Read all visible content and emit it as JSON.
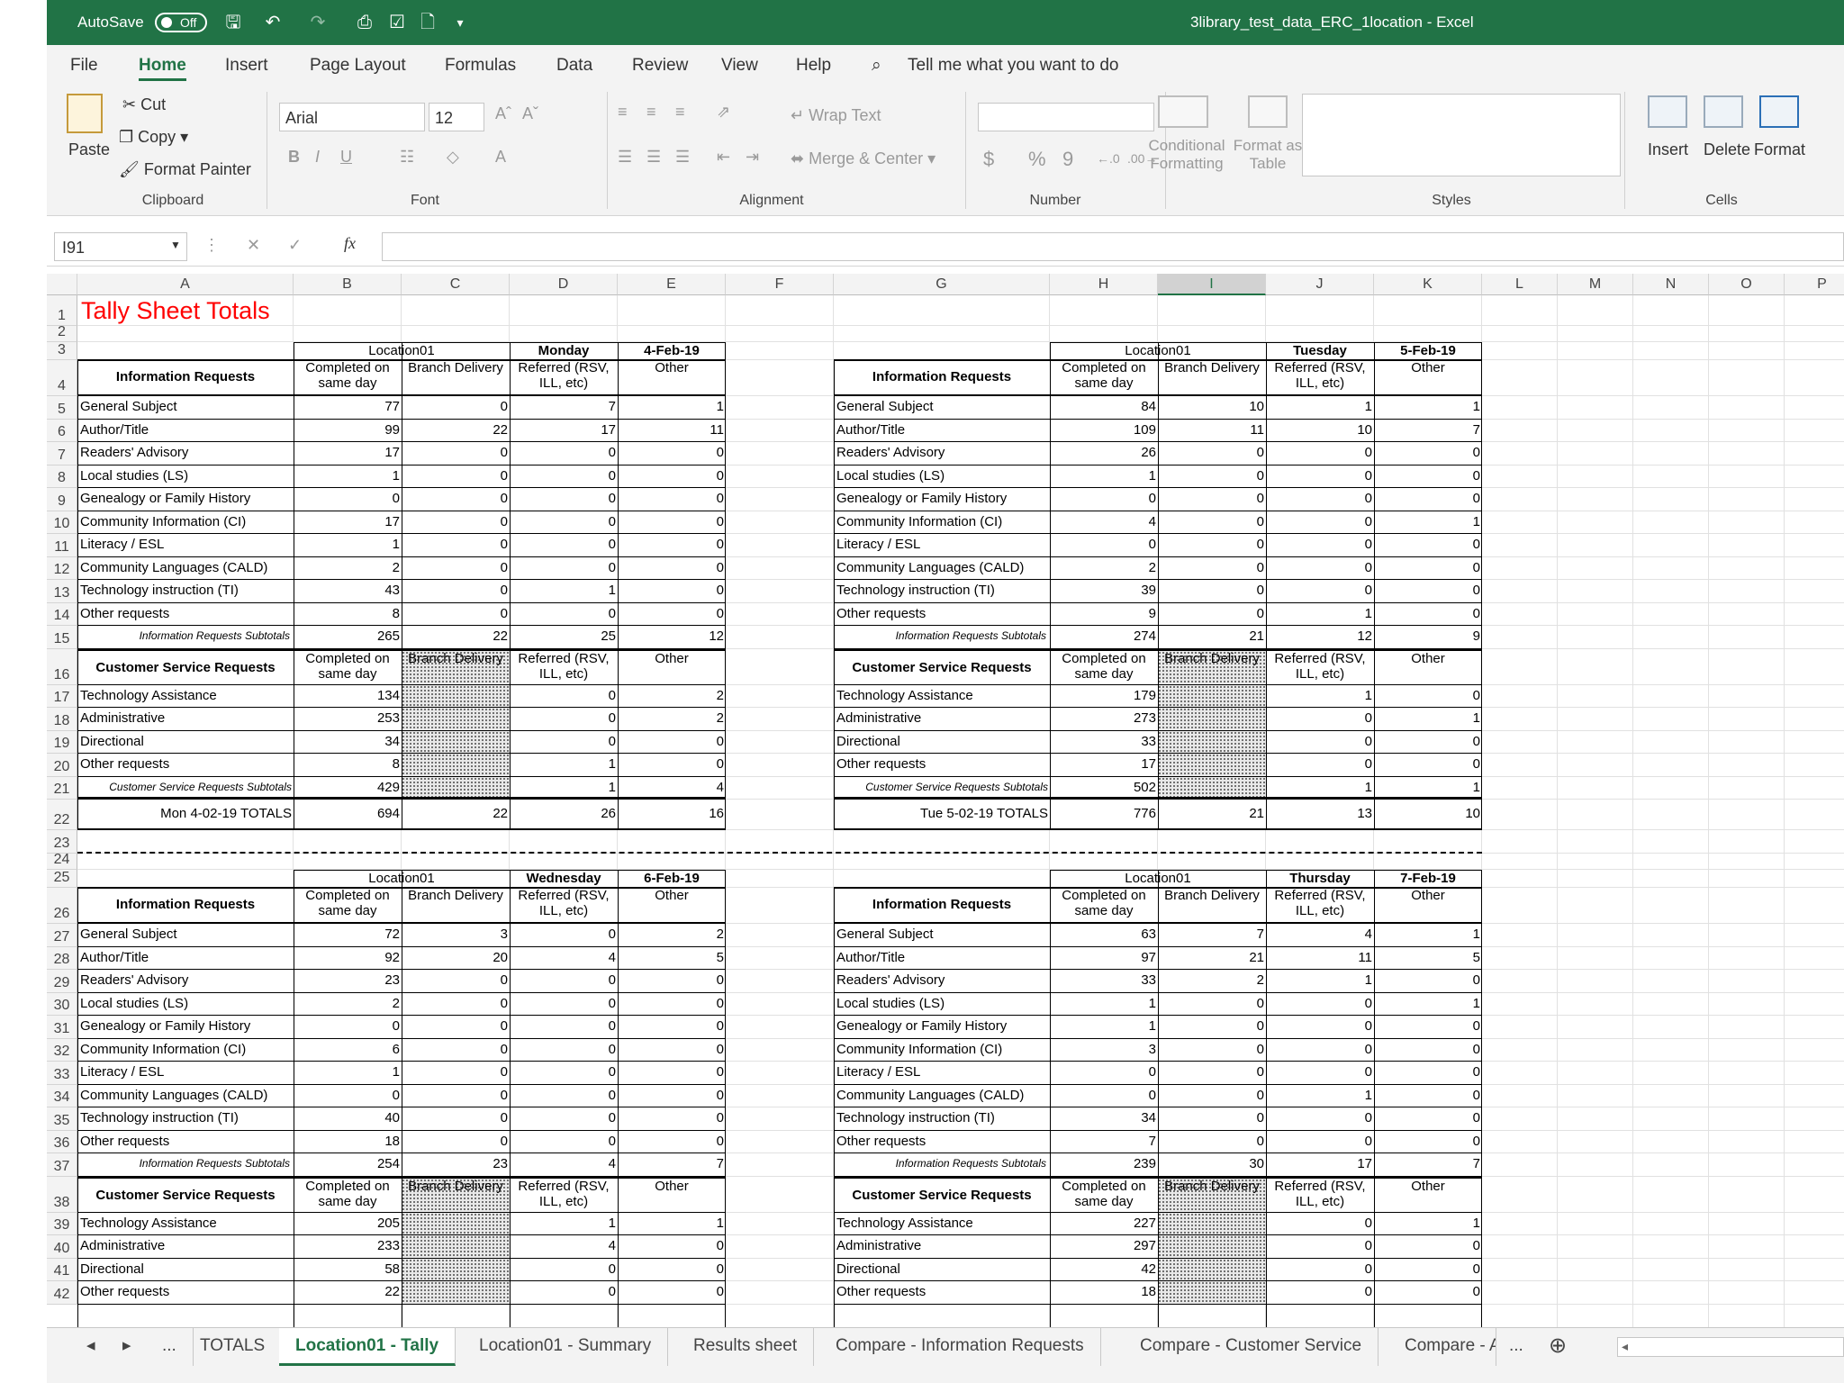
{
  "window": {
    "title": "3library_test_data_ERC_1location  -  Excel",
    "autosave_label": "AutoSave",
    "autosave_state": "Off"
  },
  "menu": {
    "tabs": [
      "File",
      "Home",
      "Insert",
      "Page Layout",
      "Formulas",
      "Data",
      "Review",
      "View",
      "Help"
    ],
    "active": "Home",
    "tell_me": "Tell me what you want to do"
  },
  "ribbon": {
    "clipboard": {
      "paste": "Paste",
      "cut": "Cut",
      "copy": "Copy",
      "format_painter": "Format Painter",
      "group": "Clipboard"
    },
    "font": {
      "name": "Arial",
      "size": "12",
      "group": "Font",
      "bold": "B",
      "italic": "I",
      "underline": "U",
      "grow": "Aˆ",
      "shrink": "Aˇ"
    },
    "alignment": {
      "wrap": "Wrap Text",
      "merge": "Merge & Center",
      "group": "Alignment"
    },
    "number": {
      "group": "Number",
      "currency": "$",
      "percent": "%",
      "comma": "9"
    },
    "styles": {
      "conditional": "Conditional Formatting",
      "format_as_table": "Format as Table",
      "group": "Styles"
    },
    "cells": {
      "insert": "Insert",
      "delete": "Delete",
      "format": "Format",
      "group": "Cells"
    }
  },
  "formula_bar": {
    "name_box": "I91",
    "formula": "",
    "fx": "fx",
    "cancel": "✕",
    "confirm": "✓"
  },
  "columns": [
    "A",
    "B",
    "C",
    "D",
    "E",
    "F",
    "G",
    "H",
    "I",
    "J",
    "K",
    "L",
    "M",
    "N",
    "O",
    "P"
  ],
  "selected_column": "I",
  "rows": [
    "1",
    "2",
    "3",
    "4",
    "5",
    "6",
    "7",
    "8",
    "9",
    "10",
    "11",
    "12",
    "13",
    "14",
    "15",
    "16",
    "17",
    "18",
    "19",
    "20",
    "21",
    "22",
    "23",
    "24",
    "25",
    "26",
    "27",
    "28",
    "29",
    "30",
    "31",
    "32",
    "33",
    "34",
    "35",
    "36",
    "37",
    "38",
    "39",
    "40",
    "41",
    "42"
  ],
  "sheet_title": "Tally Sheet Totals",
  "headers": {
    "location": "Location01",
    "info_requests": "Information Requests",
    "cs_requests": "Customer Service Requests",
    "completed": "Completed on same day",
    "branch": "Branch Delivery",
    "referred": "Referred (RSV, ILL, etc)",
    "other": "Other",
    "info_subtotals": "Information Requests Subtotals",
    "cs_subtotals": "Customer Service Requests Subtotals"
  },
  "info_labels": [
    "General Subject",
    "Author/Title",
    "Readers' Advisory",
    "Local studies (LS)",
    "Genealogy or Family History",
    "Community Information (CI)",
    "Literacy / ESL",
    "Community Languages (CALD)",
    "Technology instruction (TI)",
    "Other requests"
  ],
  "cs_labels": [
    "Technology Assistance",
    "Administrative",
    "Directional",
    "Other requests"
  ],
  "blocks": [
    {
      "day": "Monday",
      "date": "4-Feb-19",
      "info": [
        [
          "77",
          "0",
          "7",
          "1"
        ],
        [
          "99",
          "22",
          "17",
          "11"
        ],
        [
          "17",
          "0",
          "0",
          "0"
        ],
        [
          "1",
          "0",
          "0",
          "0"
        ],
        [
          "0",
          "0",
          "0",
          "0"
        ],
        [
          "17",
          "0",
          "0",
          "0"
        ],
        [
          "1",
          "0",
          "0",
          "0"
        ],
        [
          "2",
          "0",
          "0",
          "0"
        ],
        [
          "43",
          "0",
          "1",
          "0"
        ],
        [
          "8",
          "0",
          "0",
          "0"
        ]
      ],
      "info_sub": [
        "265",
        "22",
        "25",
        "12"
      ],
      "cs": [
        [
          "134",
          "",
          "0",
          "2"
        ],
        [
          "253",
          "",
          "0",
          "2"
        ],
        [
          "34",
          "",
          "0",
          "0"
        ],
        [
          "8",
          "",
          "1",
          "0"
        ]
      ],
      "cs_sub": [
        "429",
        "",
        "1",
        "4"
      ],
      "totals_label": "Mon 4-02-19 TOTALS",
      "totals": [
        "694",
        "22",
        "26",
        "16"
      ]
    },
    {
      "day": "Tuesday",
      "date": "5-Feb-19",
      "info": [
        [
          "84",
          "10",
          "1",
          "1"
        ],
        [
          "109",
          "11",
          "10",
          "7"
        ],
        [
          "26",
          "0",
          "0",
          "0"
        ],
        [
          "1",
          "0",
          "0",
          "0"
        ],
        [
          "0",
          "0",
          "0",
          "0"
        ],
        [
          "4",
          "0",
          "0",
          "1"
        ],
        [
          "0",
          "0",
          "0",
          "0"
        ],
        [
          "2",
          "0",
          "0",
          "0"
        ],
        [
          "39",
          "0",
          "0",
          "0"
        ],
        [
          "9",
          "0",
          "1",
          "0"
        ]
      ],
      "info_sub": [
        "274",
        "21",
        "12",
        "9"
      ],
      "cs": [
        [
          "179",
          "",
          "1",
          "0"
        ],
        [
          "273",
          "",
          "0",
          "1"
        ],
        [
          "33",
          "",
          "0",
          "0"
        ],
        [
          "17",
          "",
          "0",
          "0"
        ]
      ],
      "cs_sub": [
        "502",
        "",
        "1",
        "1"
      ],
      "totals_label": "Tue 5-02-19 TOTALS",
      "totals": [
        "776",
        "21",
        "13",
        "10"
      ]
    },
    {
      "day": "Wednesday",
      "date": "6-Feb-19",
      "info": [
        [
          "72",
          "3",
          "0",
          "2"
        ],
        [
          "92",
          "20",
          "4",
          "5"
        ],
        [
          "23",
          "0",
          "0",
          "0"
        ],
        [
          "2",
          "0",
          "0",
          "0"
        ],
        [
          "0",
          "0",
          "0",
          "0"
        ],
        [
          "6",
          "0",
          "0",
          "0"
        ],
        [
          "1",
          "0",
          "0",
          "0"
        ],
        [
          "0",
          "0",
          "0",
          "0"
        ],
        [
          "40",
          "0",
          "0",
          "0"
        ],
        [
          "18",
          "0",
          "0",
          "0"
        ]
      ],
      "info_sub": [
        "254",
        "23",
        "4",
        "7"
      ],
      "cs": [
        [
          "205",
          "",
          "1",
          "1"
        ],
        [
          "233",
          "",
          "4",
          "0"
        ],
        [
          "58",
          "",
          "0",
          "0"
        ],
        [
          "22",
          "",
          "0",
          "0"
        ]
      ]
    },
    {
      "day": "Thursday",
      "date": "7-Feb-19",
      "info": [
        [
          "63",
          "7",
          "4",
          "1"
        ],
        [
          "97",
          "21",
          "11",
          "5"
        ],
        [
          "33",
          "2",
          "1",
          "0"
        ],
        [
          "1",
          "0",
          "0",
          "1"
        ],
        [
          "1",
          "0",
          "0",
          "0"
        ],
        [
          "3",
          "0",
          "0",
          "0"
        ],
        [
          "0",
          "0",
          "0",
          "0"
        ],
        [
          "0",
          "0",
          "1",
          "0"
        ],
        [
          "34",
          "0",
          "0",
          "0"
        ],
        [
          "7",
          "0",
          "0",
          "0"
        ]
      ],
      "info_sub": [
        "239",
        "30",
        "17",
        "7"
      ],
      "cs": [
        [
          "227",
          "",
          "0",
          "1"
        ],
        [
          "297",
          "",
          "0",
          "0"
        ],
        [
          "42",
          "",
          "0",
          "0"
        ],
        [
          "18",
          "",
          "0",
          "0"
        ]
      ]
    }
  ],
  "sheet_tabs": [
    "TOTALS",
    "Location01 - Tally",
    "Location01 - Summary",
    "Results sheet",
    "Compare - Information Requests",
    "Compare - Customer Service",
    "Compare - A"
  ],
  "active_sheet": "Location01 - Tally",
  "sheet_nav": {
    "ellipsis": "...",
    "prev": "◂",
    "next": "▸",
    "more": "...",
    "add": "⊕"
  }
}
